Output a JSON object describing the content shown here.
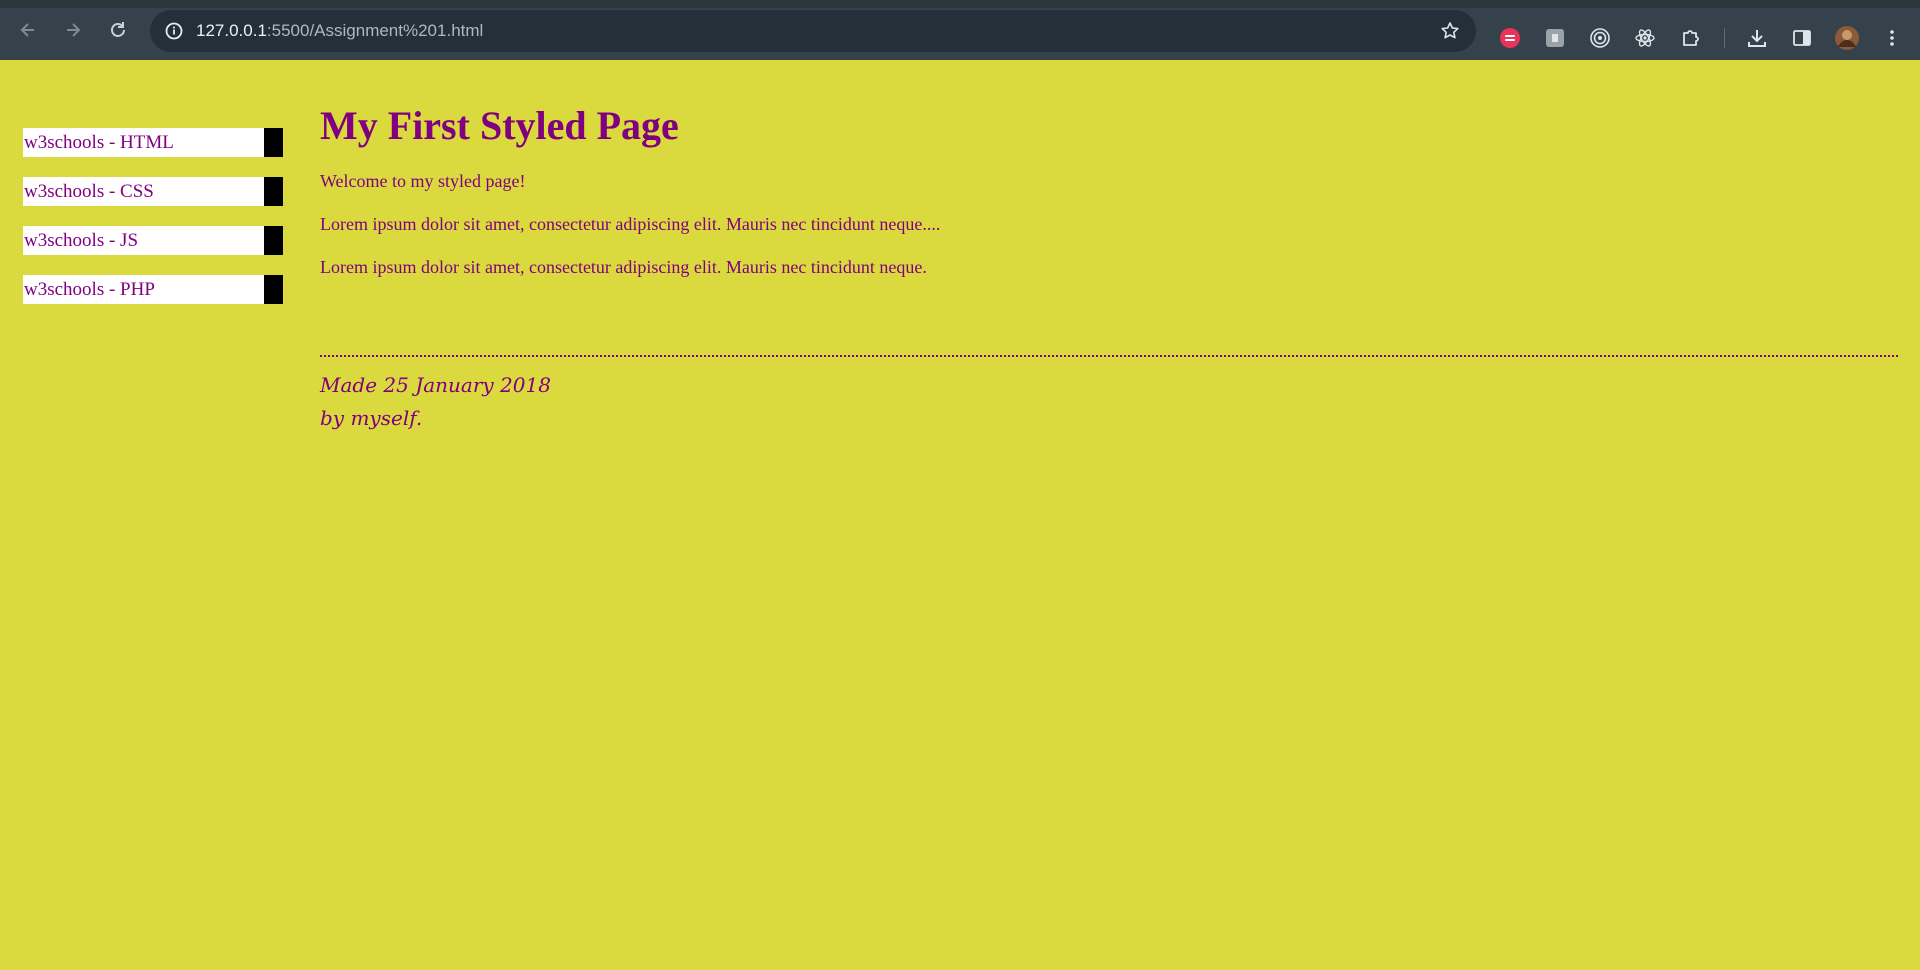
{
  "browser": {
    "url_host": "127.0.0.1",
    "url_rest": ":5500/Assignment%201.html",
    "icons": {
      "back": "arrow-left-icon",
      "forward": "arrow-right-icon",
      "reload": "reload-icon",
      "site_info": "info-icon",
      "bookmark": "star-icon",
      "downloads": "download-icon",
      "side_panel": "side-panel-icon",
      "menu": "kebab-menu-icon"
    }
  },
  "sidebar": {
    "items": [
      {
        "label": "w3schools - HTML"
      },
      {
        "label": "w3schools - CSS"
      },
      {
        "label": "w3schools - JS"
      },
      {
        "label": "w3schools - PHP"
      }
    ]
  },
  "main": {
    "title": "My First Styled Page",
    "paragraphs": [
      "Welcome to my styled page!",
      "Lorem ipsum dolor sit amet, consectetur adipiscing elit. Mauris nec tincidunt neque....",
      "Lorem ipsum dolor sit amet, consectetur adipiscing elit. Mauris nec tincidunt neque."
    ]
  },
  "footer": {
    "line1": "Made 25 January 2018",
    "line2": "by myself."
  },
  "colors": {
    "page_background": "#dada3e",
    "text": "#800080",
    "link_background": "#ffffff",
    "link_border": "#000000",
    "browser_bar": "#35424b"
  }
}
